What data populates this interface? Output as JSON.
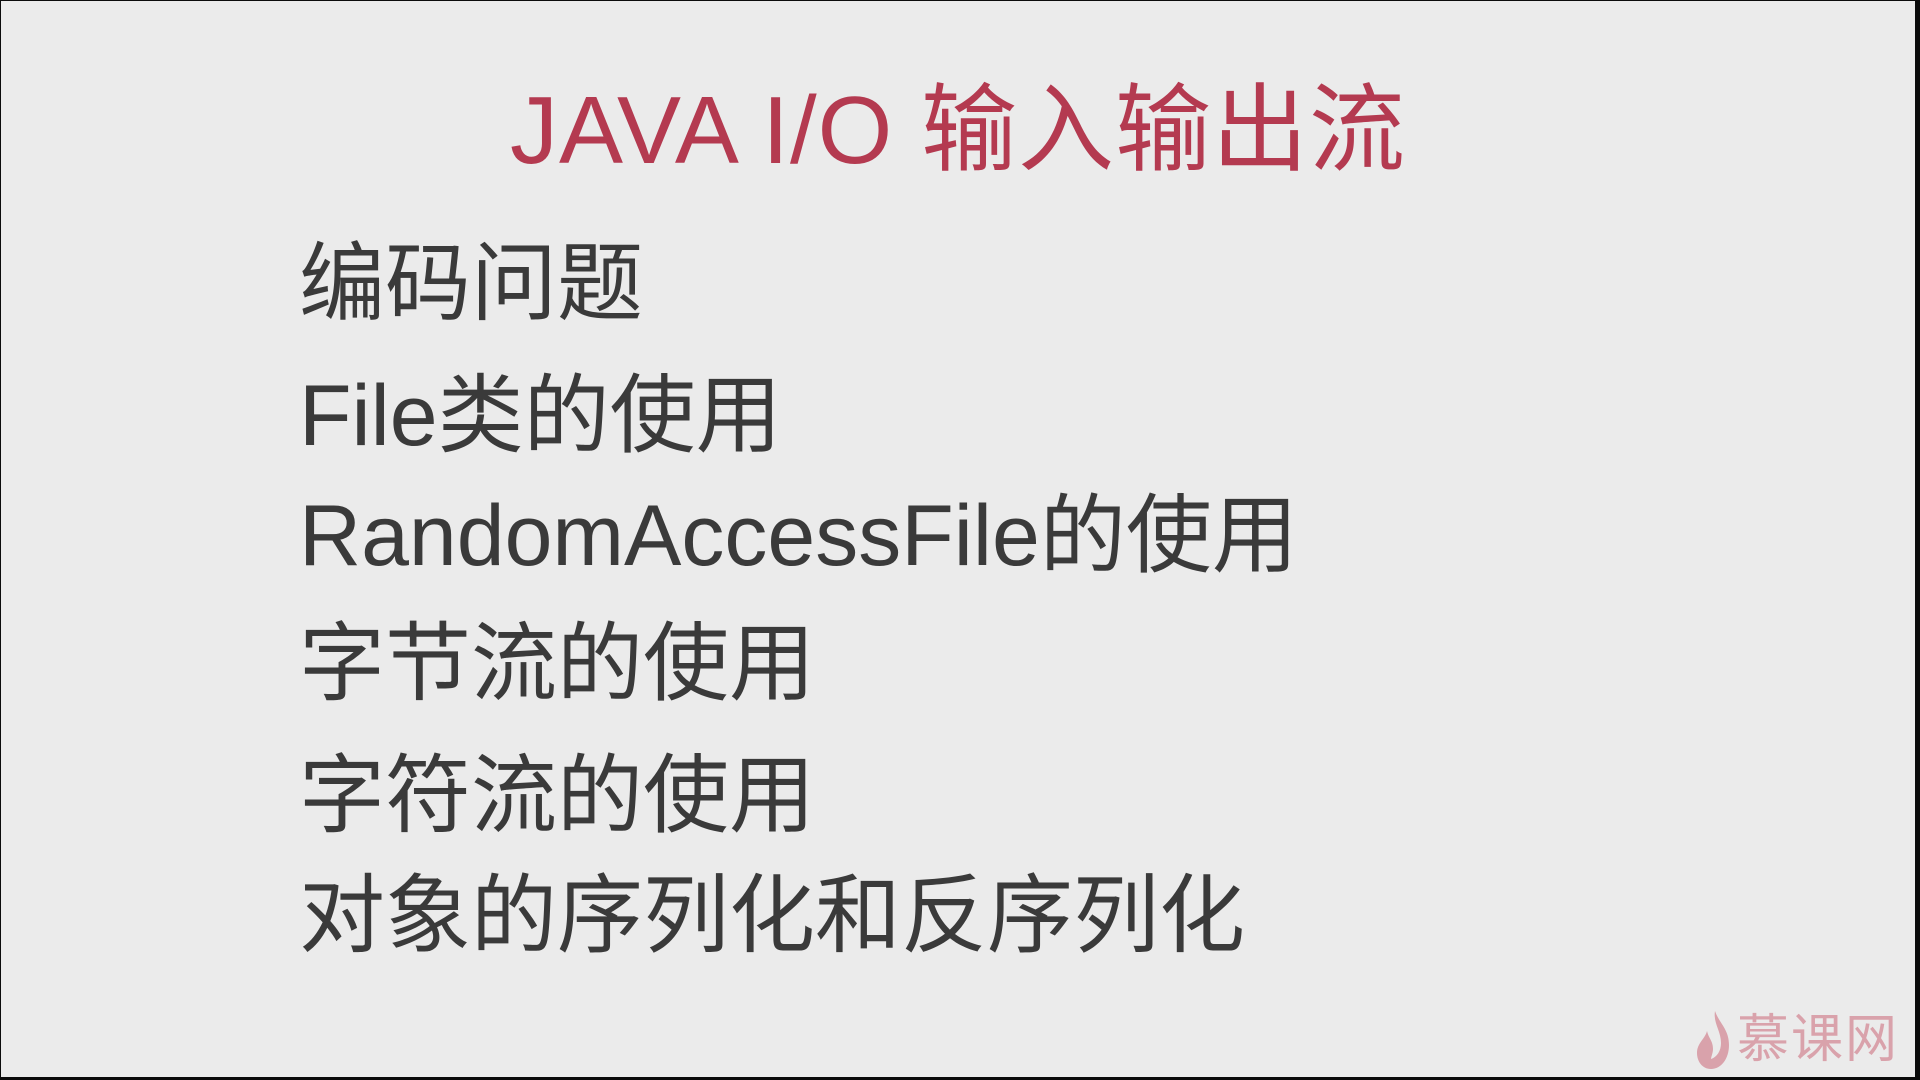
{
  "slide": {
    "title": "JAVA I/O 输入输出流",
    "topics": [
      "编码问题",
      "File类的使用",
      "RandomAccessFile的使用",
      "字节流的使用",
      "字符流的使用",
      "对象的序列化和反序列化"
    ]
  },
  "watermark": {
    "icon": "flame-icon",
    "text": "慕课网"
  },
  "colors": {
    "title": "#b43a50",
    "body_text": "#3a3a3a",
    "background": "#ebebeb",
    "watermark": "#c54a5e"
  }
}
